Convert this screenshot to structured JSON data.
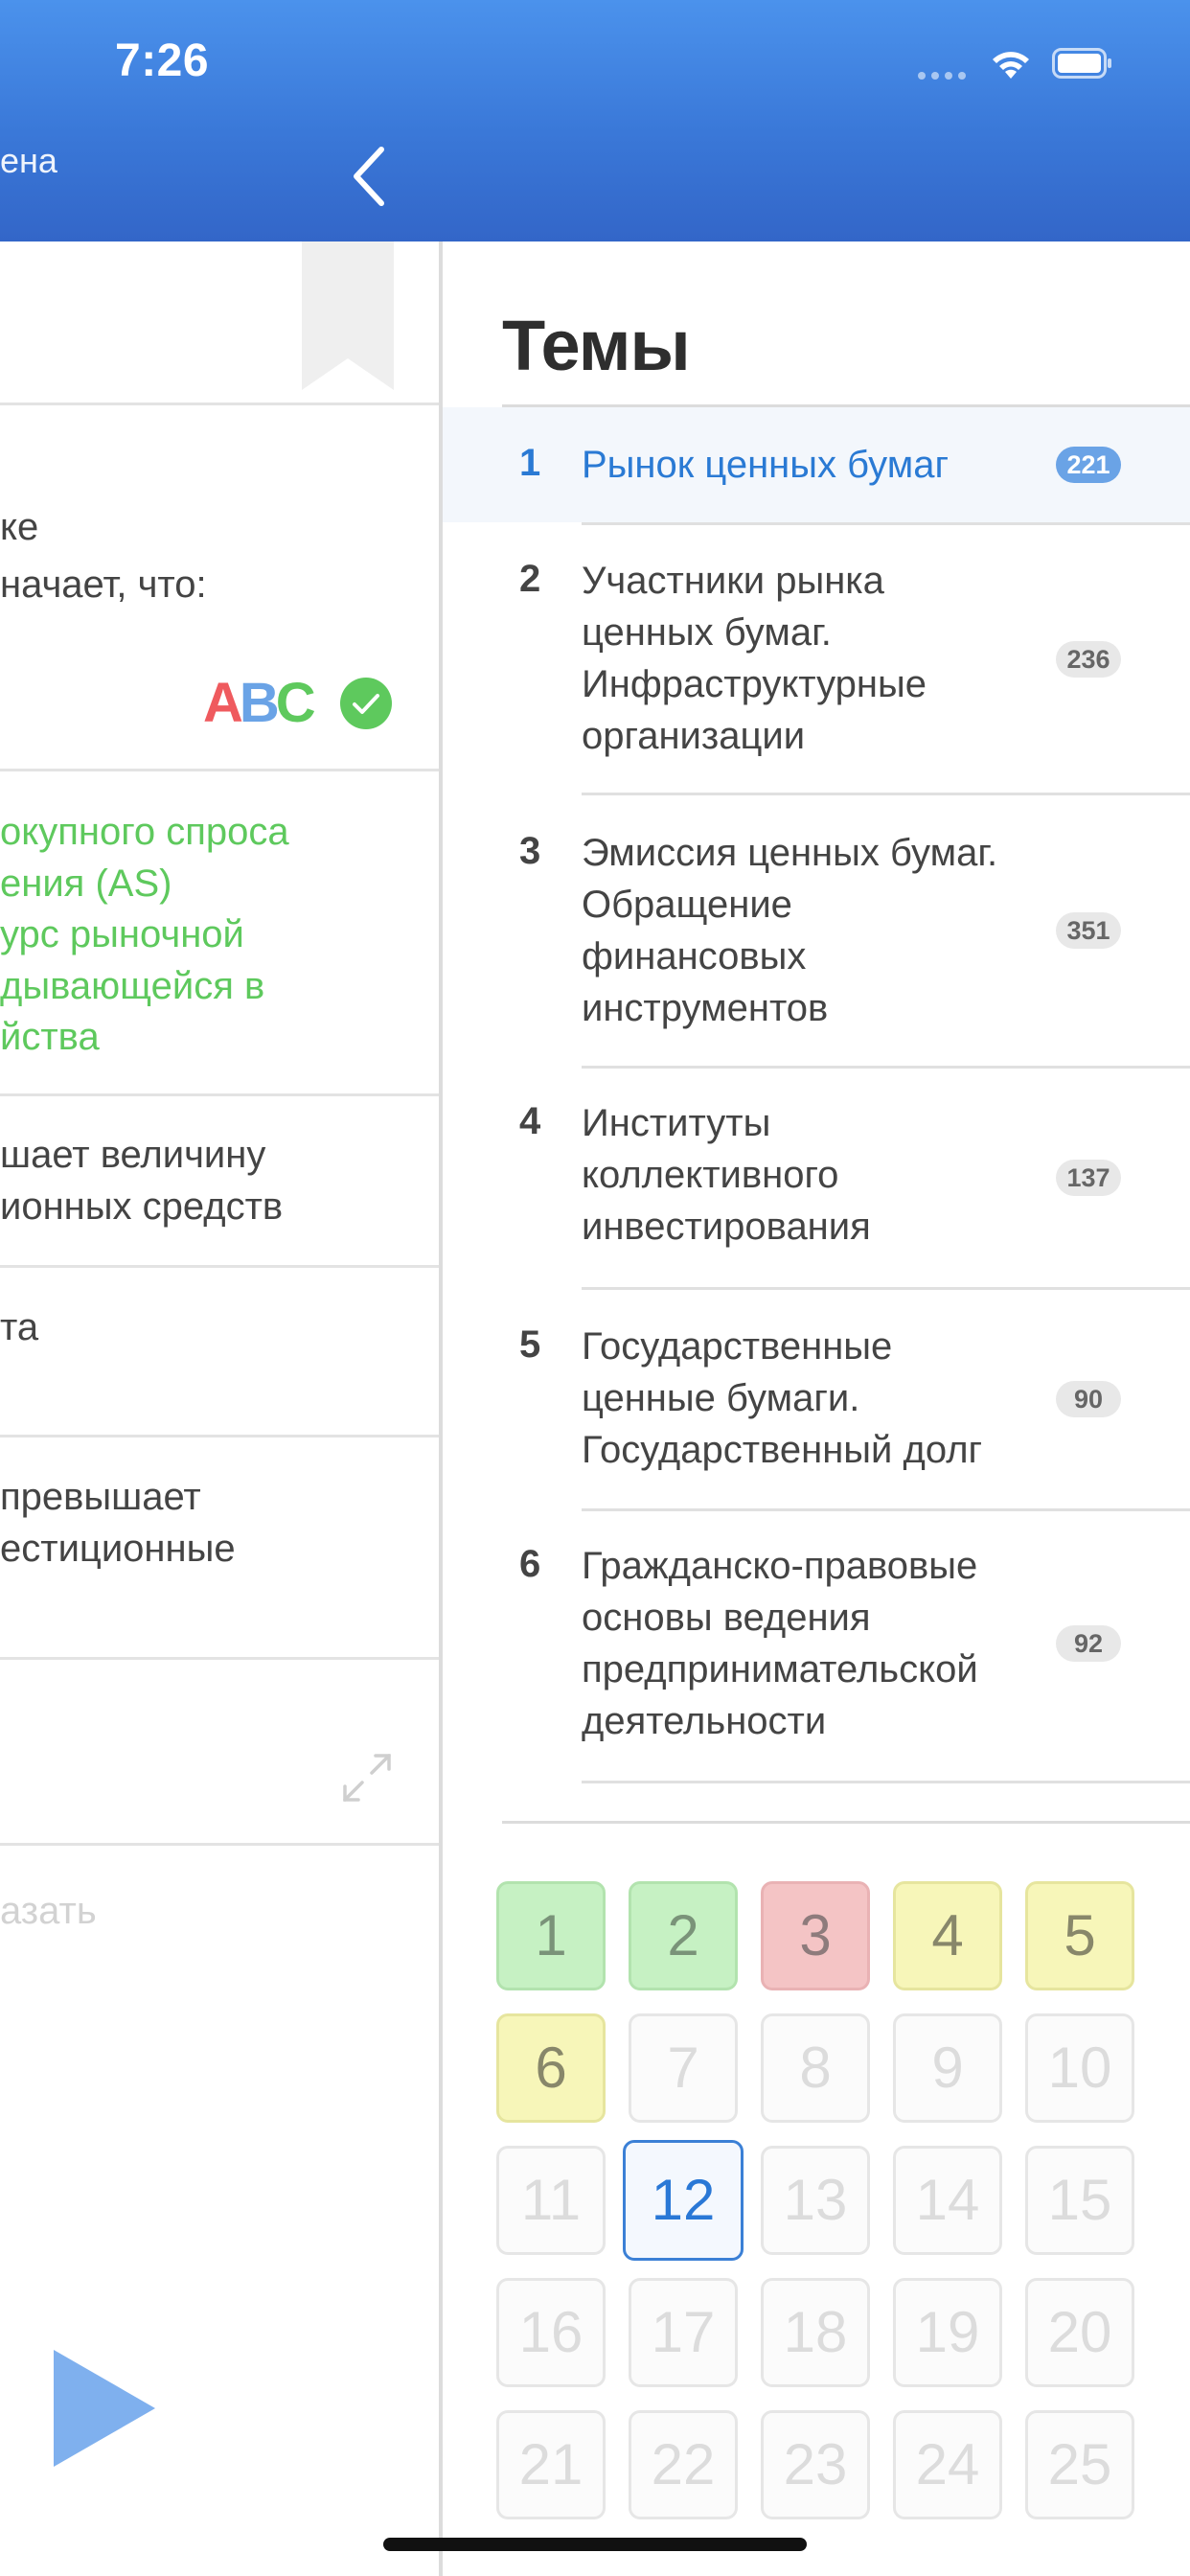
{
  "status_bar": {
    "time": "7:26"
  },
  "header": {
    "back_label": "ена"
  },
  "colors": {
    "header_blue": "#3a78d8",
    "accent_blue": "#2a7ad4",
    "correct_green": "#c6f1c3",
    "wrong_red": "#f4c4c5",
    "partial_yellow": "#f7f6b9",
    "answer_green": "#5ec95d"
  },
  "left_pane": {
    "question_lines": [
      "ке",
      "начает, что:"
    ],
    "abc_letters": [
      "A",
      "B",
      "C"
    ],
    "answers": [
      {
        "lines": [
          "окупного спроса",
          "ения (AS)",
          "урс рыночной",
          "дывающейся в",
          "йства"
        ],
        "status": "correct"
      },
      {
        "lines": [
          "шает величину",
          "ионных средств"
        ],
        "status": "neutral"
      },
      {
        "lines": [
          "та"
        ],
        "status": "neutral"
      },
      {
        "lines": [
          "превышает",
          "естиционные"
        ],
        "status": "neutral"
      }
    ],
    "show_label": "азать"
  },
  "topics": {
    "title": "Темы",
    "items": [
      {
        "number": "1",
        "lines": [
          "Рынок ценных бумаг"
        ],
        "count": "221",
        "active": true
      },
      {
        "number": "2",
        "lines": [
          "Участники рынка",
          "ценных бумаг.",
          "Инфраструктурные",
          "организации"
        ],
        "count": "236",
        "active": false
      },
      {
        "number": "3",
        "lines": [
          "Эмиссия ценных бумаг.",
          "Обращение",
          "финансовых",
          "инструментов"
        ],
        "count": "351",
        "active": false
      },
      {
        "number": "4",
        "lines": [
          "Институты",
          "коллективного",
          "инвестирования"
        ],
        "count": "137",
        "active": false
      },
      {
        "number": "5",
        "lines": [
          "Государственные",
          "ценные бумаги.",
          "Государственный долг"
        ],
        "count": "90",
        "active": false
      },
      {
        "number": "6",
        "lines": [
          "Гражданско-правовые",
          "основы ведения",
          "предпринимательской",
          "деятельности"
        ],
        "count": "92",
        "active": false
      }
    ]
  },
  "question_grid": {
    "cells": [
      {
        "label": "1",
        "status": "correct"
      },
      {
        "label": "2",
        "status": "correct"
      },
      {
        "label": "3",
        "status": "wrong"
      },
      {
        "label": "4",
        "status": "partial"
      },
      {
        "label": "5",
        "status": "partial"
      },
      {
        "label": "6",
        "status": "partial"
      },
      {
        "label": "7",
        "status": "none"
      },
      {
        "label": "8",
        "status": "none"
      },
      {
        "label": "9",
        "status": "none"
      },
      {
        "label": "10",
        "status": "none"
      },
      {
        "label": "11",
        "status": "none"
      },
      {
        "label": "12",
        "status": "current"
      },
      {
        "label": "13",
        "status": "none"
      },
      {
        "label": "14",
        "status": "none"
      },
      {
        "label": "15",
        "status": "none"
      },
      {
        "label": "16",
        "status": "none"
      },
      {
        "label": "17",
        "status": "none"
      },
      {
        "label": "18",
        "status": "none"
      },
      {
        "label": "19",
        "status": "none"
      },
      {
        "label": "20",
        "status": "none"
      },
      {
        "label": "21",
        "status": "none"
      },
      {
        "label": "22",
        "status": "none"
      },
      {
        "label": "23",
        "status": "none"
      },
      {
        "label": "24",
        "status": "none"
      },
      {
        "label": "25",
        "status": "none"
      }
    ]
  }
}
